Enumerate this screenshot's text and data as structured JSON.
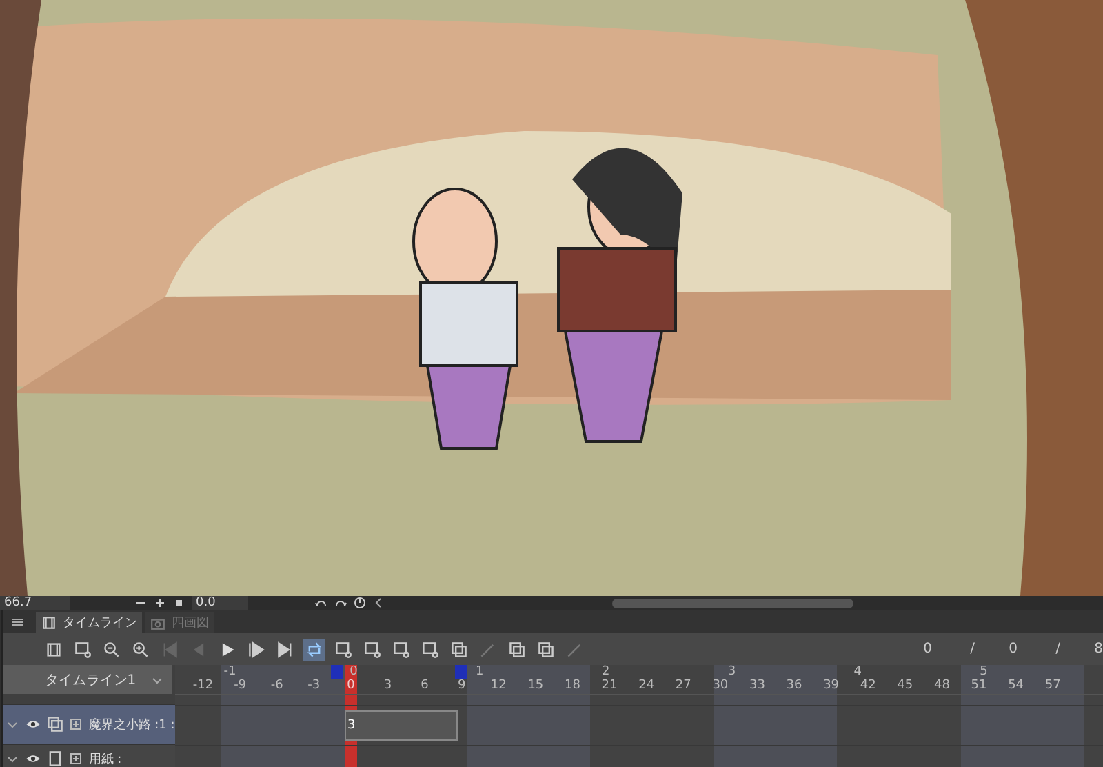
{
  "canvas": {
    "zoom": "66.7",
    "angle": "0.0"
  },
  "panel": {
    "tabs": [
      {
        "label": "タイムライン",
        "selected": true
      },
      {
        "label": "四画図",
        "selected": false
      }
    ]
  },
  "timeline": {
    "name": "タイムライン1",
    "counter": [
      "0",
      "/",
      "0",
      "/",
      "8"
    ],
    "seconds": [
      "-1",
      "0",
      "1",
      "2",
      "3",
      "4",
      "5"
    ],
    "frames": [
      {
        "label": "-12",
        "current": false
      },
      {
        "label": "-9",
        "current": false
      },
      {
        "label": "-6",
        "current": false
      },
      {
        "label": "-3",
        "current": false
      },
      {
        "label": "0",
        "current": true
      },
      {
        "label": "3",
        "current": false
      },
      {
        "label": "6",
        "current": false
      },
      {
        "label": "9",
        "current": false
      },
      {
        "label": "12",
        "current": false
      },
      {
        "label": "15",
        "current": false
      },
      {
        "label": "18",
        "current": false
      },
      {
        "label": "21",
        "current": false
      },
      {
        "label": "24",
        "current": false
      },
      {
        "label": "27",
        "current": false
      },
      {
        "label": "30",
        "current": false
      },
      {
        "label": "33",
        "current": false
      },
      {
        "label": "36",
        "current": false
      },
      {
        "label": "39",
        "current": false
      },
      {
        "label": "42",
        "current": false
      },
      {
        "label": "45",
        "current": false
      },
      {
        "label": "48",
        "current": false
      },
      {
        "label": "51",
        "current": false
      },
      {
        "label": "54",
        "current": false
      },
      {
        "label": "57",
        "current": false
      }
    ],
    "layers": [
      {
        "name": "魔界之小路 :1 :",
        "selected": true,
        "visible": true,
        "cell": "3"
      },
      {
        "name": "用紙 :",
        "selected": false,
        "visible": true
      }
    ]
  }
}
